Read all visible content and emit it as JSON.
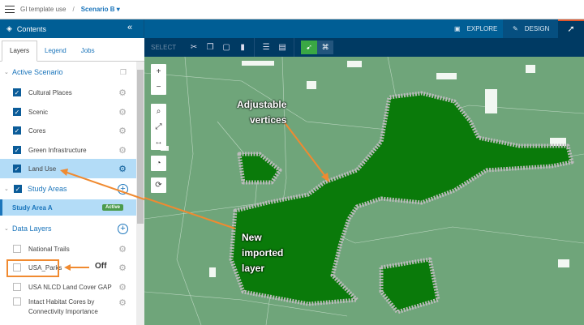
{
  "topbar": {
    "project": "GI template use",
    "separator": "/",
    "scenario": "Scenario B ▾"
  },
  "header": {
    "contents_title": "Contents",
    "collapse_icon": "«",
    "explore": "EXPLORE",
    "design": "DESIGN"
  },
  "toolbar": {
    "select": "SELECT"
  },
  "tabs": [
    "Layers",
    "Legend",
    "Jobs"
  ],
  "sections": {
    "active_scenario": {
      "label": "Active Scenario",
      "items": [
        "Cultural Places",
        "Scenic",
        "Cores",
        "Green Infrastructure",
        "Land Use"
      ]
    },
    "study_areas": {
      "label": "Study Areas",
      "item": "Study Area A",
      "badge": "Active"
    },
    "data_layers": {
      "label": "Data Layers",
      "items": [
        "National Trails",
        "USA_Parks",
        "USA NLCD Land Cover GAP",
        "Intact Habitat Cores by Connectivity Importance"
      ]
    }
  },
  "annotations": {
    "vertices_line1": "Adjustable",
    "vertices_line2": "vertices",
    "imported_line1": "New",
    "imported_line2": "imported",
    "imported_line3": "layer",
    "off": "Off"
  },
  "colors": {
    "brand": "#005e95",
    "toolbar": "#003a63",
    "map": "#6fa57a",
    "polygon": "#0a7a0a",
    "arrow": "#f08a30",
    "active": "#3aa744"
  }
}
